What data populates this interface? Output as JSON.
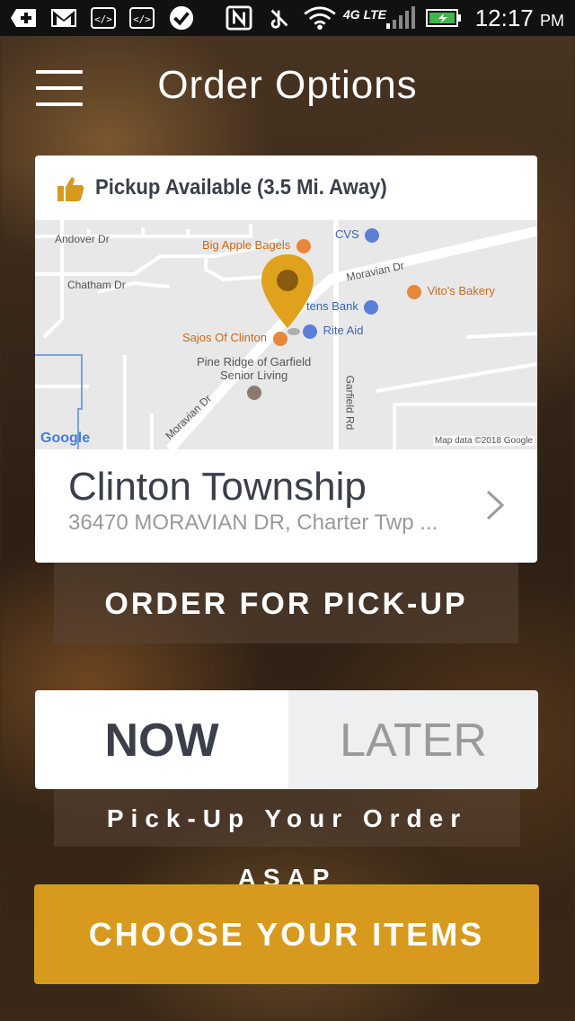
{
  "status_bar": {
    "time": "12:17",
    "ampm": "PM",
    "network": "4G LTE",
    "icons": [
      "plus-icon",
      "gmail-icon",
      "code-icon",
      "code-icon",
      "check-icon",
      "nfc-icon",
      "mute-icon",
      "wifi-icon",
      "signal-icon",
      "battery-icon"
    ]
  },
  "header": {
    "title": "Order Options",
    "menu_icon": "hamburger-menu-icon"
  },
  "location_card": {
    "pickup_text": "Pickup Available (3.5 Mi. Away)",
    "pickup_icon": "thumbs-up-icon",
    "map": {
      "streets": [
        "Andover Dr",
        "Chatham Dr",
        "Moravian Dr",
        "Moravian Dr",
        "Garfield Rd"
      ],
      "places": [
        "Big Apple Bagels",
        "CVS",
        "Vito's Bakery",
        "Citizens Bank",
        "Rite Aid",
        "Sajos Of Clinton",
        "Pine Ridge of Garfield",
        "Senior Living"
      ],
      "citizens_bank_visible": "tens Bank",
      "google_logo": "Google",
      "attribution": "Map data ©2018 Google"
    },
    "location_name": "Clinton Township",
    "location_address": "36470 MORAVIAN DR, Charter Twp ..."
  },
  "order_type_label": "ORDER FOR PICK-UP",
  "timing": {
    "options": [
      "NOW",
      "LATER"
    ],
    "selected": "NOW",
    "description": "Pick-Up Your Order ASAP"
  },
  "cta_label": "CHOOSE YOUR ITEMS",
  "colors": {
    "accent": "#d79a1f",
    "text_dark": "#3a3f4a",
    "text_muted": "#9a9a9a",
    "map_pin": "#e0a21d"
  }
}
